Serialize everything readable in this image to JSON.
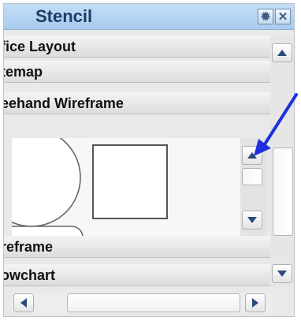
{
  "window": {
    "title": "Stencil",
    "settings_icon": "gear-icon",
    "close_icon": "close-icon"
  },
  "categories": [
    {
      "label": "fice Layout"
    },
    {
      "label": "temap"
    },
    {
      "label": "eehand Wireframe",
      "expanded": true
    },
    {
      "label": "reframe"
    },
    {
      "label": "owchart"
    }
  ],
  "shapes": [
    {
      "icon": "circle-shape-icon"
    },
    {
      "icon": "square-shape-icon"
    },
    {
      "icon": "rounded-rectangle-shape-icon"
    }
  ],
  "annotation": {
    "color": "#1f2fe0",
    "icon": "pointer-arrow-icon"
  },
  "colors": {
    "titlebar": "#b7d4f2",
    "title_text": "#1e3b66",
    "arrow": "#2b4a7a"
  }
}
